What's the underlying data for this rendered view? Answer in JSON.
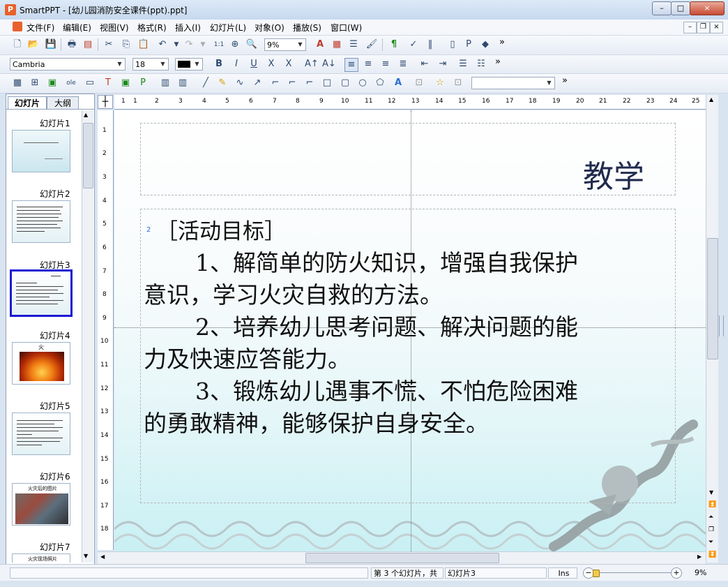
{
  "window": {
    "app_name": "SmartPPT",
    "title": "SmartPPT - [幼儿园消防安全课件(ppt).ppt]",
    "minimize": "–",
    "maximize": "□",
    "close": "×"
  },
  "menu": {
    "items": [
      "文件(F)",
      "编辑(E)",
      "视图(V)",
      "格式(R)",
      "插入(I)",
      "幻灯片(L)",
      "对象(O)",
      "播放(S)",
      "窗口(W)"
    ],
    "mdi_minimize": "–",
    "mdi_restore": "❐",
    "mdi_close": "×"
  },
  "toolbar": {
    "zoom_value": "9%",
    "font_name": "Cambria",
    "font_size": "18",
    "font_color": "#000000",
    "overflow": "»"
  },
  "sidebar": {
    "tabs": [
      "幻灯片",
      "大纲"
    ],
    "slides": [
      {
        "label": "幻灯片1",
        "selected": false
      },
      {
        "label": "幻灯片2",
        "selected": false
      },
      {
        "label": "幻灯片3",
        "selected": true
      },
      {
        "label": "幻灯片4",
        "selected": false
      },
      {
        "label": "幻灯片5",
        "selected": false
      },
      {
        "label": "幻灯片6",
        "selected": false
      },
      {
        "label": "幻灯片7",
        "selected": false
      }
    ],
    "thumb4_text": "火",
    "thumb6_text": "火灾后的图片",
    "thumb7_text": "火灾现场照片"
  },
  "ruler": {
    "top_ticks": [
      "1",
      "1",
      "2",
      "3",
      "4",
      "5",
      "6",
      "7",
      "8",
      "9",
      "10",
      "11",
      "12",
      "13",
      "14",
      "15",
      "16",
      "17",
      "18",
      "19",
      "20",
      "21",
      "22",
      "23",
      "24",
      "25"
    ],
    "left_ticks": [
      "1",
      "2",
      "3",
      "4",
      "5",
      "6",
      "7",
      "8",
      "9",
      "10",
      "11",
      "12",
      "13",
      "14",
      "15",
      "16",
      "17",
      "18"
    ]
  },
  "slide": {
    "title": "教学",
    "paragraph_marker": "2",
    "lines": [
      "［活动目标］",
      "1、解简单的防火知识，增强自我保护",
      "意识，学习火灾自救的方法。",
      "2、培养幼儿思考问题、解决问题的能",
      "力及快速应答能力。",
      "3、锻炼幼儿遇事不慌、不怕危险困难",
      "的勇敢精神，能够保护自身安全。"
    ]
  },
  "status": {
    "slide_info": "第 3 个幻灯片，共",
    "slide_name": "幻灯片3",
    "mode": "Ins",
    "zoom": "9%"
  }
}
